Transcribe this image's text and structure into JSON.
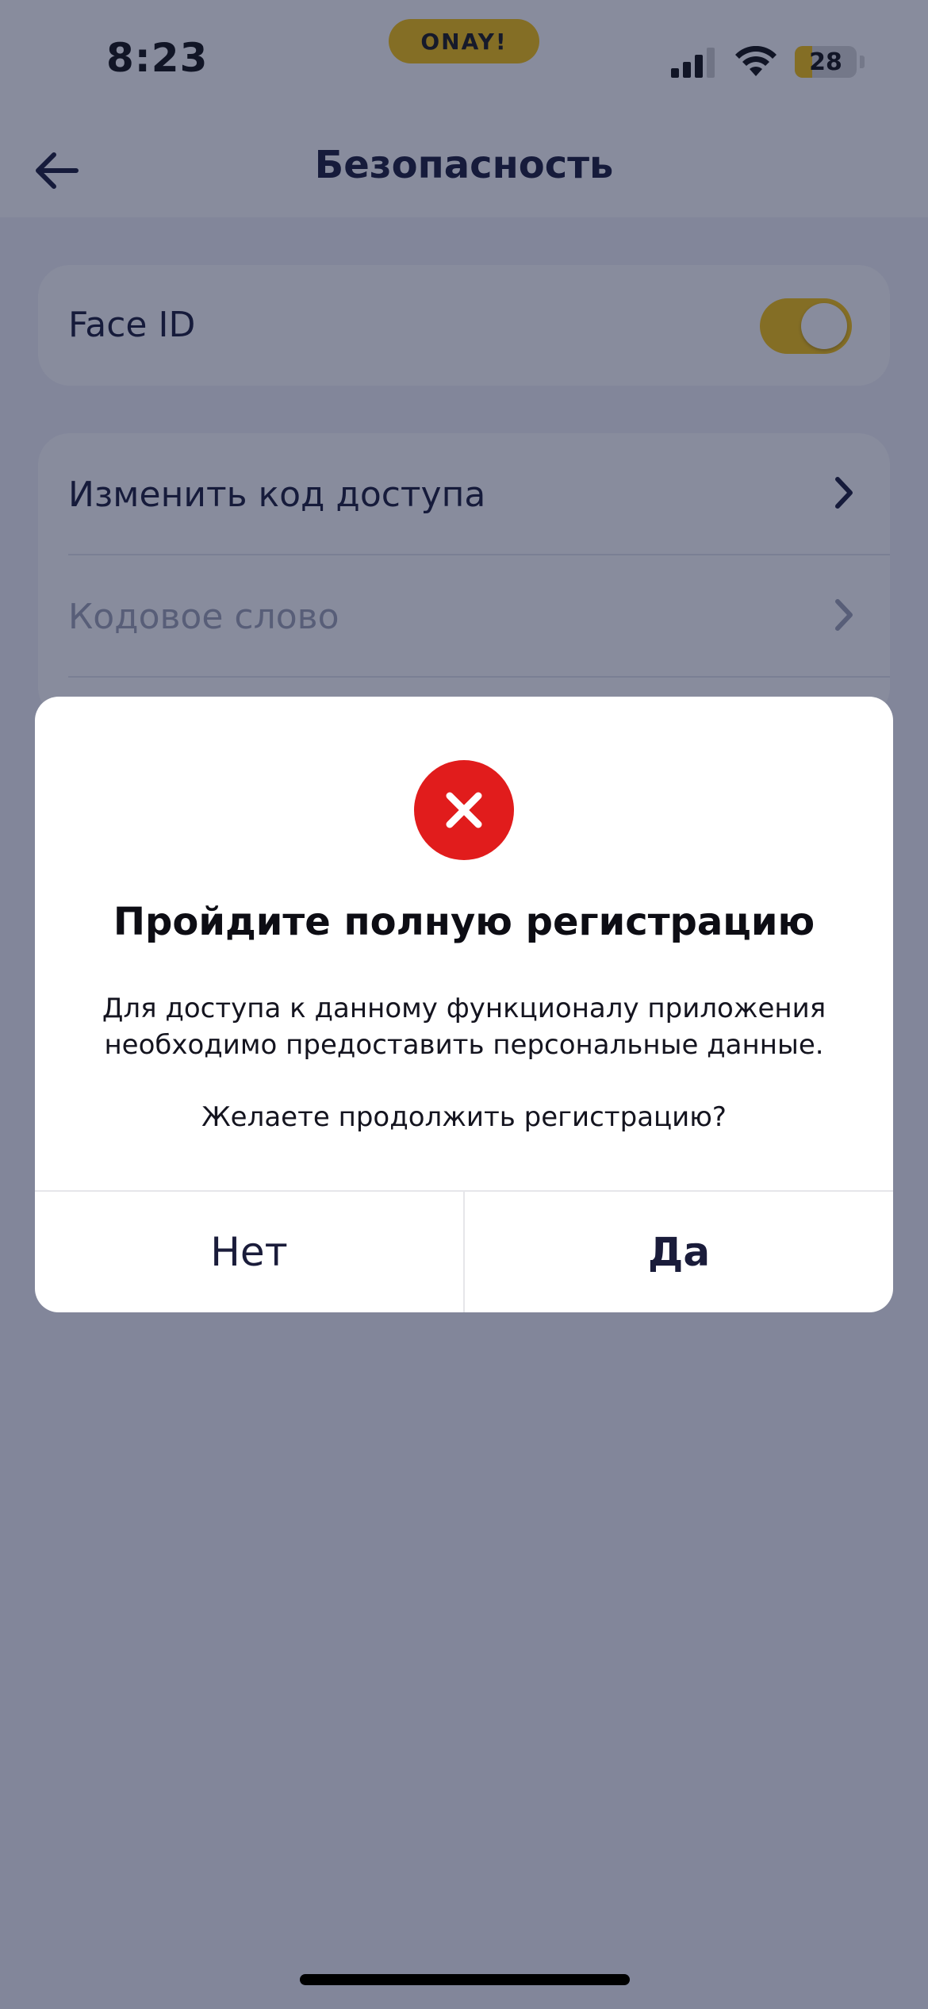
{
  "status_bar": {
    "time": "8:23",
    "brand": "ONAY!",
    "battery_level": "28",
    "icons": [
      "signal-icon",
      "wifi-icon",
      "battery-icon"
    ]
  },
  "nav": {
    "title": "Безопасность",
    "back_icon": "arrow-left-icon"
  },
  "settings": {
    "face_id": {
      "label": "Face ID",
      "enabled": true
    },
    "items": [
      {
        "label": "Изменить код доступа",
        "enabled": true
      },
      {
        "label": "Кодовое слово",
        "enabled": false
      }
    ]
  },
  "dialog": {
    "icon": "error-x-icon",
    "title": "Пройдите полную регистрацию",
    "message": "Для доступа к данному функционалу приложения необходимо предоставить персональные данные.",
    "question": "Желаете продолжить регистрацию?",
    "buttons": {
      "no": "Нет",
      "yes": "Да"
    }
  },
  "colors": {
    "accent": "#f6c20f",
    "error": "#e11c1c",
    "text_primary": "#1a1c3a",
    "text_disabled": "#9ea2b4",
    "background": "#f2f3f8"
  }
}
